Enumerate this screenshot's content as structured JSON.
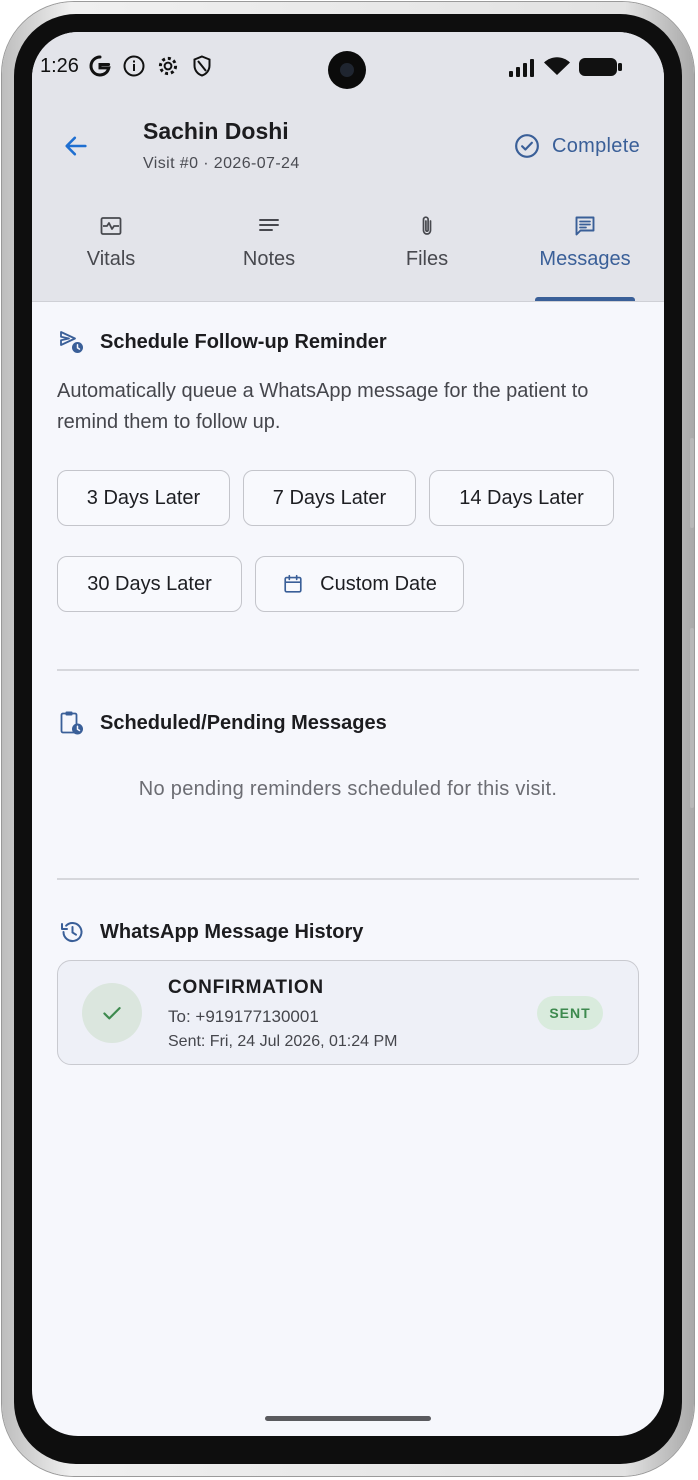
{
  "status_bar": {
    "time": "1:26"
  },
  "header": {
    "patient_name": "Sachin Doshi",
    "visit_info": "Visit #0 · 2026-07-24",
    "complete_label": "Complete"
  },
  "tabs": [
    {
      "label": "Vitals",
      "icon": "vitals-icon",
      "active": false
    },
    {
      "label": "Notes",
      "icon": "notes-icon",
      "active": false
    },
    {
      "label": "Files",
      "icon": "paperclip-icon",
      "active": false
    },
    {
      "label": "Messages",
      "icon": "message-icon",
      "active": true
    }
  ],
  "reminder": {
    "title": "Schedule Follow-up Reminder",
    "description": "Automatically queue a WhatsApp message for the patient to remind them to follow up.",
    "options": [
      "3 Days Later",
      "7 Days Later",
      "14 Days Later",
      "30 Days Later",
      "Custom Date"
    ]
  },
  "pending": {
    "title": "Scheduled/Pending Messages",
    "empty_text": "No pending reminders scheduled for this visit."
  },
  "history": {
    "title": "WhatsApp Message History",
    "items": [
      {
        "type": "CONFIRMATION",
        "to": "To: +919177130001",
        "sent": "Sent: Fri, 24 Jul 2026, 01:24 PM",
        "status": "SENT"
      }
    ]
  },
  "colors": {
    "accent": "#3a5f98",
    "header_bg": "#e3e4ea",
    "screen_bg": "#f6f7fc",
    "success_green": "#3d8a4e",
    "back_arrow": "#1f6fd1"
  }
}
